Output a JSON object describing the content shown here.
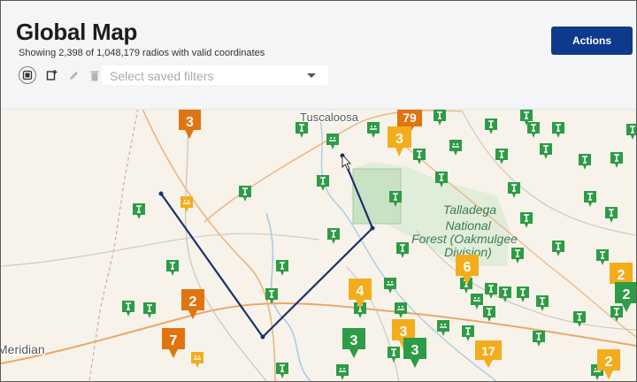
{
  "header": {
    "title": "Global Map",
    "subtitle": "Showing 2,398 of 1,048,179 radios with valid coordinates",
    "actions_label": "Actions"
  },
  "toolbar": {
    "icons": [
      "new-filter-icon",
      "add-filter-icon",
      "edit-icon",
      "delete-icon"
    ],
    "filter_placeholder": "Select saved filters"
  },
  "map": {
    "labels": {
      "city_tuscaloosa": "Tuscaloosa",
      "forest": [
        "Talladega",
        "National",
        "Forest (Oakmulgee",
        "Division)"
      ],
      "city_meridian": "Meridian"
    },
    "cluster_counts": [
      "3",
      "79",
      "3",
      "2",
      "7",
      "4",
      "3",
      "3",
      "3",
      "6",
      "17",
      "2",
      "2",
      "2"
    ],
    "colors": {
      "green_marker": "#2e9b47",
      "yellow_marker": "#f3ad1c",
      "orange_marker": "#e07410",
      "route": "#1a3270",
      "accent_button": "#0f3a8c"
    }
  }
}
